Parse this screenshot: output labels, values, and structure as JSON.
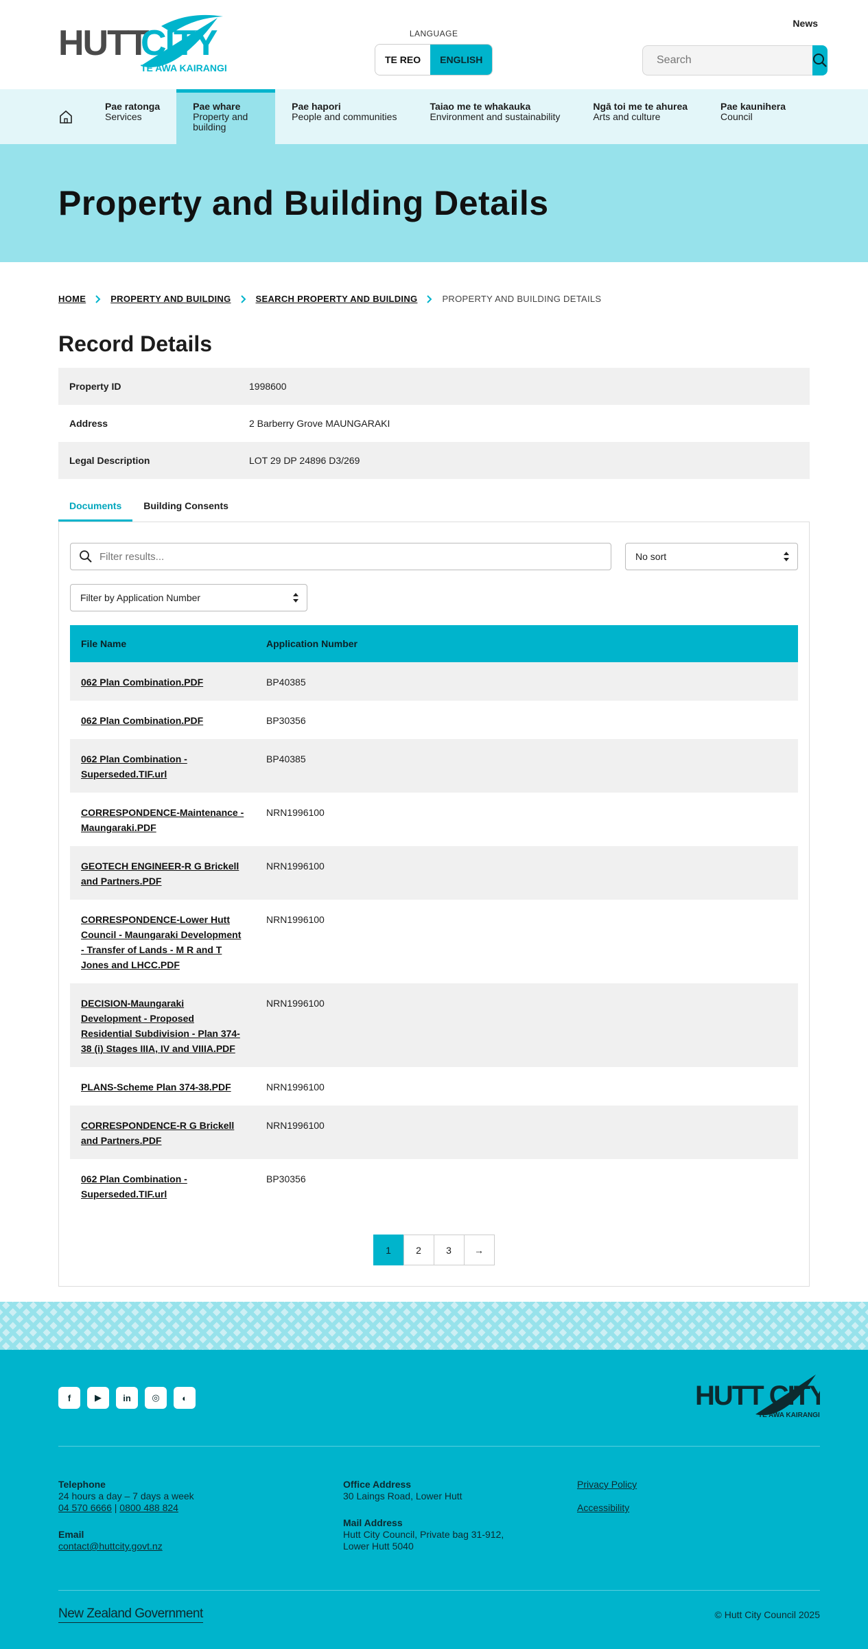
{
  "header": {
    "logo_main": "HUTT CITY",
    "logo_sub": "TE AWA KAIRANGI",
    "language_label": "LANGUAGE",
    "lang_te_reo": "TE REO",
    "lang_english": "ENGLISH",
    "news": "News",
    "search_placeholder": "Search"
  },
  "nav": [
    {
      "title": "Pae ratonga",
      "sub": "Services"
    },
    {
      "title": "Pae whare",
      "sub": "Property and building"
    },
    {
      "title": "Pae hapori",
      "sub": "People and communities"
    },
    {
      "title": "Taiao me te whakauka",
      "sub": "Environment and sustainability"
    },
    {
      "title": "Ngā toi me te ahurea",
      "sub": "Arts and culture"
    },
    {
      "title": "Pae kaunihera",
      "sub": "Council"
    }
  ],
  "hero_title": "Property and Building Details",
  "breadcrumb": {
    "home": "HOME",
    "property": "PROPERTY AND BUILDING",
    "search": "SEARCH PROPERTY AND BUILDING",
    "current": "PROPERTY AND BUILDING DETAILS"
  },
  "record": {
    "heading": "Record Details",
    "rows": [
      {
        "label": "Property ID",
        "value": "1998600"
      },
      {
        "label": "Address",
        "value": "2 Barberry Grove MAUNGARAKI"
      },
      {
        "label": "Legal Description",
        "value": "LOT 29 DP 24896 D3/269"
      }
    ]
  },
  "tabs": {
    "documents": "Documents",
    "consents": "Building Consents"
  },
  "filters": {
    "placeholder": "Filter results...",
    "sort": "No sort",
    "app_filter": "Filter by Application Number"
  },
  "table": {
    "col_file": "File Name",
    "col_app": "Application Number",
    "rows": [
      {
        "file": "062 Plan Combination.PDF",
        "app": "BP40385"
      },
      {
        "file": "062 Plan Combination.PDF",
        "app": "BP30356"
      },
      {
        "file": "062 Plan Combination - Superseded.TIF.url",
        "app": "BP40385"
      },
      {
        "file": "CORRESPONDENCE-Maintenance - Maungaraki.PDF",
        "app": "NRN1996100"
      },
      {
        "file": "GEOTECH ENGINEER-R G Brickell and Partners.PDF",
        "app": "NRN1996100"
      },
      {
        "file": "CORRESPONDENCE-Lower Hutt Council - Maungaraki Development - Transfer of Lands - M R and T Jones and LHCC.PDF",
        "app": "NRN1996100"
      },
      {
        "file": "DECISION-Maungaraki Development - Proposed Residential Subdivision - Plan 374-38 (i) Stages IIIA, IV and VIIIA.PDF",
        "app": "NRN1996100"
      },
      {
        "file": "PLANS-Scheme Plan 374-38.PDF",
        "app": "NRN1996100"
      },
      {
        "file": "CORRESPONDENCE-R G Brickell and Partners.PDF",
        "app": "NRN1996100"
      },
      {
        "file": "062 Plan Combination - Superseded.TIF.url",
        "app": "BP30356"
      }
    ]
  },
  "pager": {
    "p1": "1",
    "p2": "2",
    "p3": "3",
    "next": "→"
  },
  "footer": {
    "socials": [
      "f",
      "▶",
      "in",
      "◎",
      "◐"
    ],
    "telephone_h": "Telephone",
    "telephone_hours": "24 hours a day – 7 days a week",
    "phone1": "04 570 6666",
    "phone_sep": " | ",
    "phone2": "0800 488 824",
    "email_h": "Email",
    "email": "contact@huttcity.govt.nz",
    "office_h": "Office Address",
    "office": "30 Laings Road, Lower Hutt",
    "mail_h": "Mail Address",
    "mail1": "Hutt City Council, Private bag 31-912,",
    "mail2": "Lower Hutt 5040",
    "privacy": "Privacy Policy",
    "accessibility": "Accessibility",
    "nzgov": "New Zealand Government",
    "copyright": "© Hutt City Council 2025"
  },
  "colors": {
    "accent": "#00b4cc",
    "light": "#97e2eb",
    "nav_bg": "#e3f6f9"
  }
}
